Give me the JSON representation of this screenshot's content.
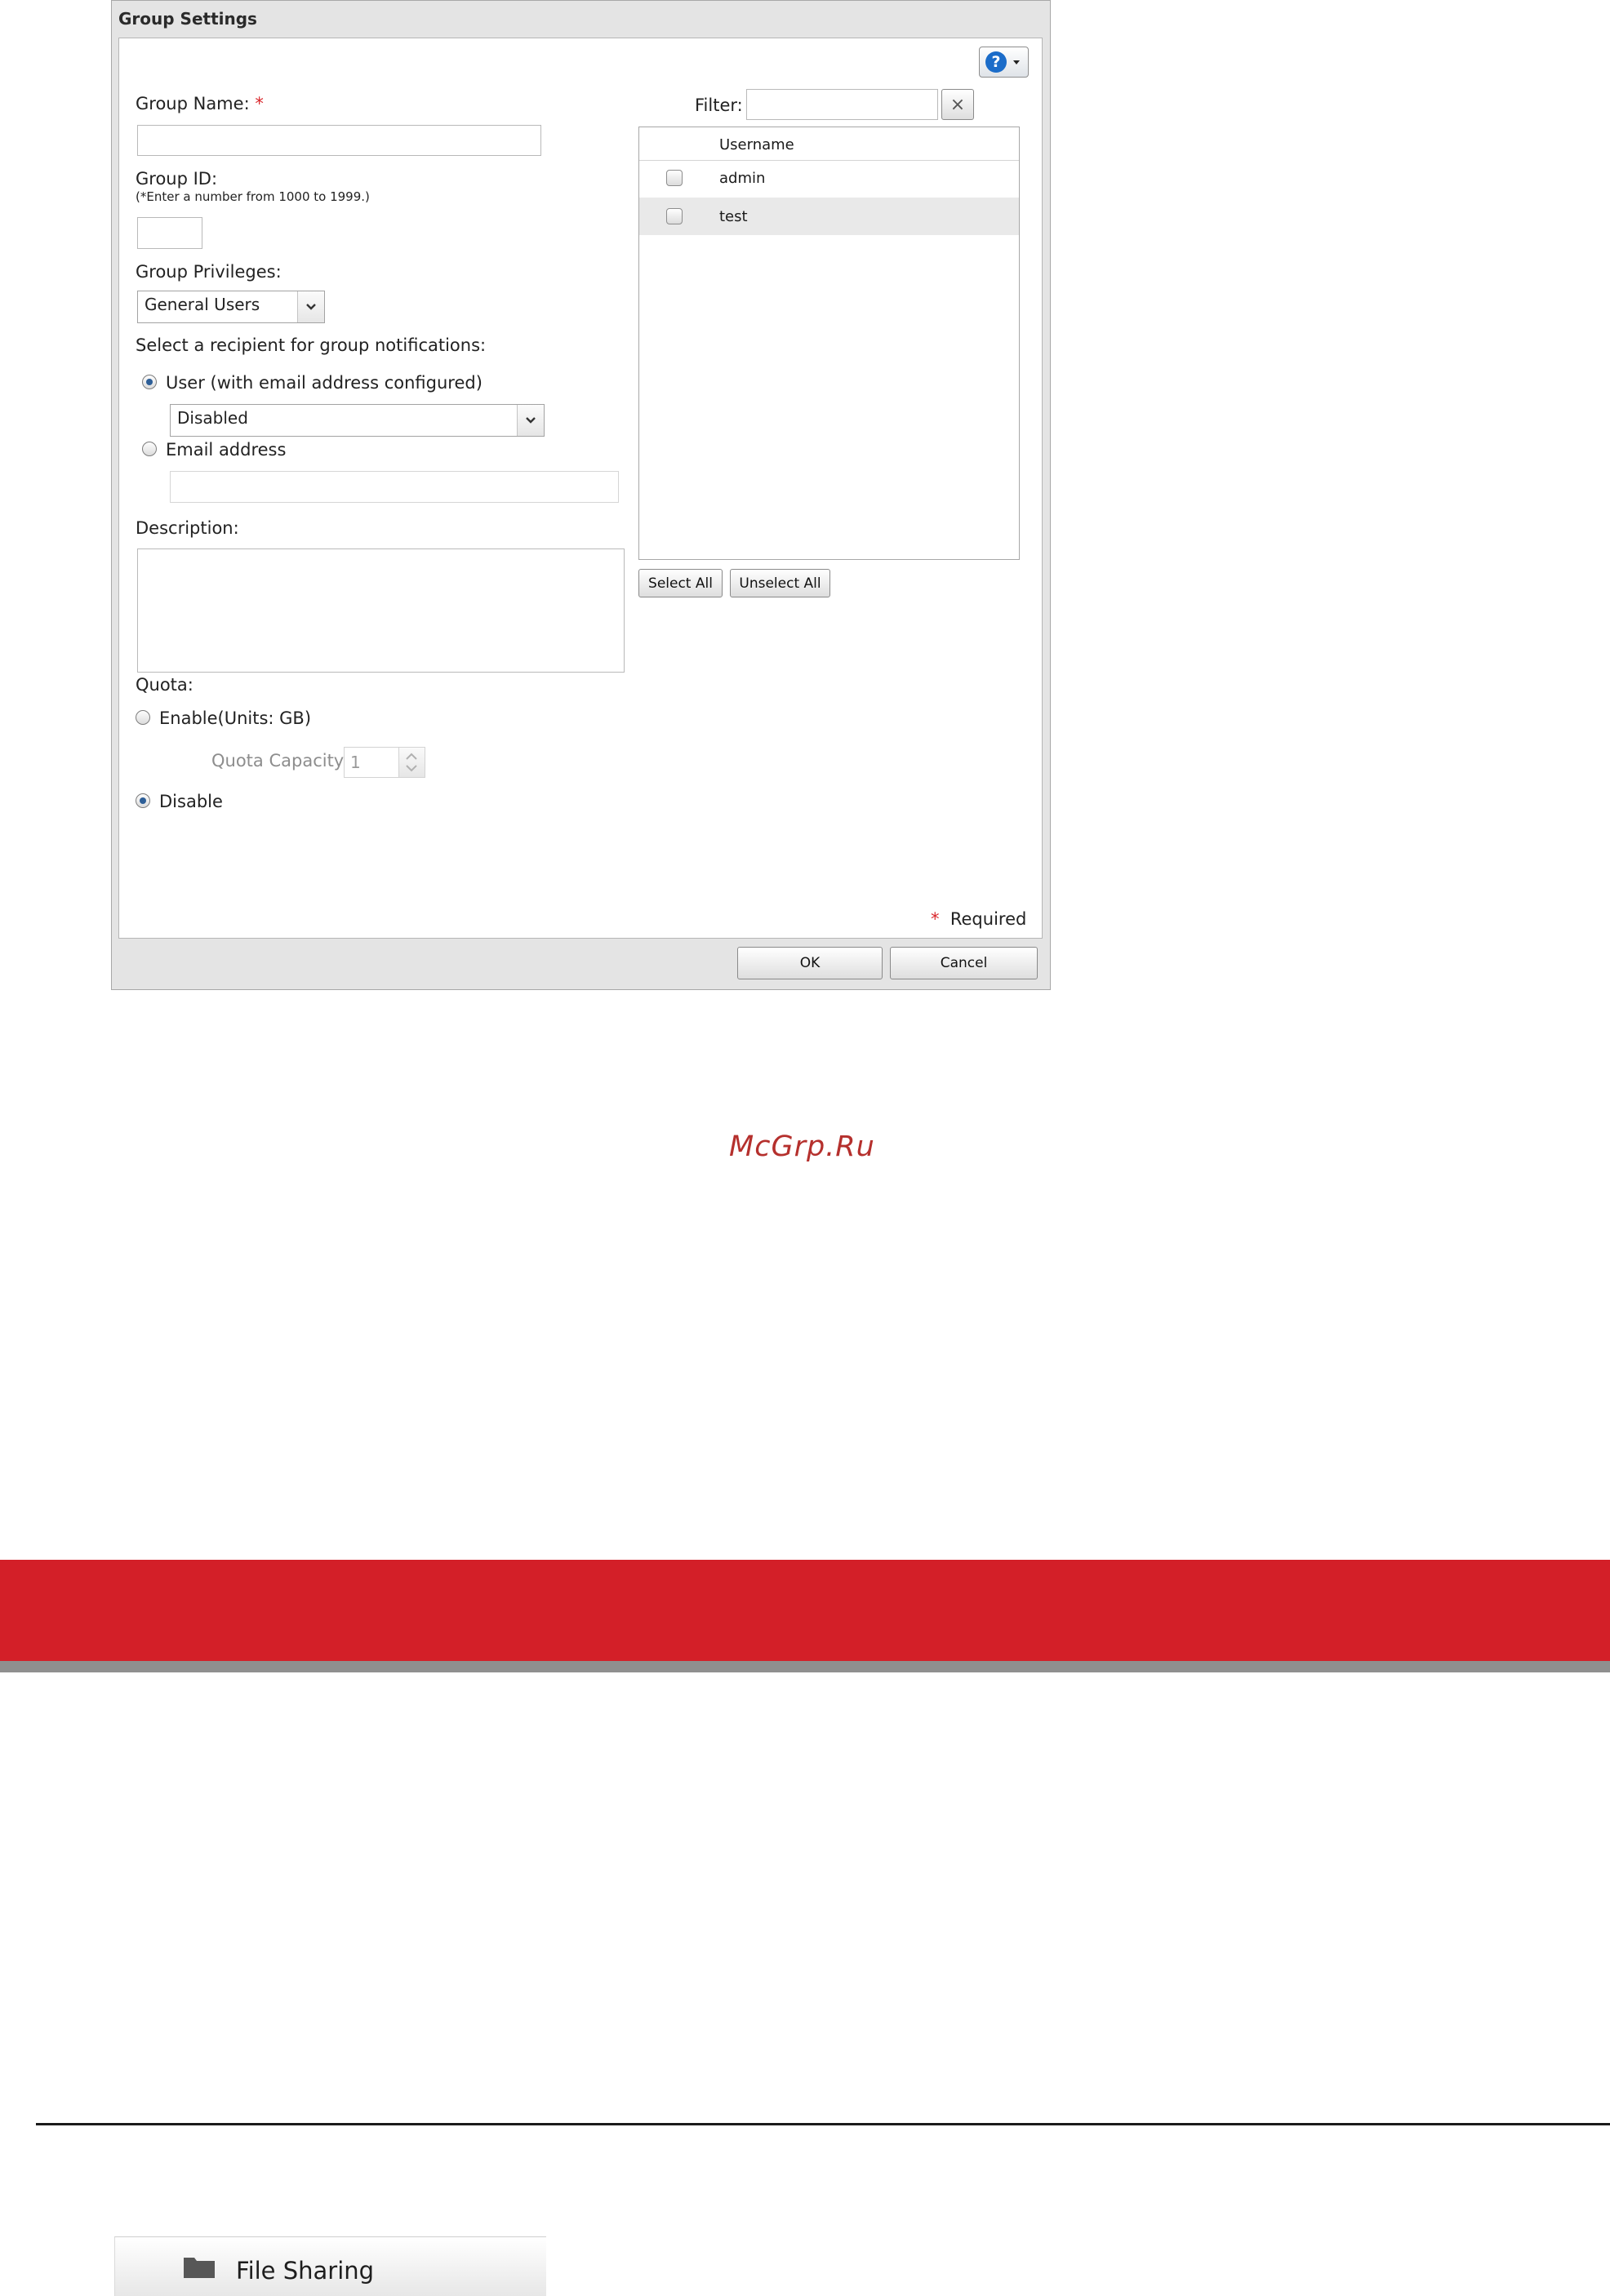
{
  "dialog": {
    "title": "Group Settings",
    "group_name_label": "Group Name:",
    "required_mark": "*",
    "group_id_label": "Group ID:",
    "group_id_hint": "(*Enter a number from 1000 to 1999.)",
    "privileges_label": "Group Privileges:",
    "privileges_value": "General Users",
    "notification_label": "Select a recipient for group notifications:",
    "radio_user_label": "User (with email address configured)",
    "user_select_value": "Disabled",
    "radio_email_label": "Email address",
    "description_label": "Description:",
    "quota_label": "Quota:",
    "quota_enable_label": "Enable(Units: GB)",
    "quota_capacity_label": "Quota Capacity:",
    "quota_capacity_value": "1",
    "quota_disable_label": "Disable",
    "filter_label": "Filter:",
    "filter_clear": "×",
    "help_glyph": "?",
    "user_list": {
      "column_header": "Username",
      "rows": [
        {
          "username": "admin"
        },
        {
          "username": "test"
        }
      ]
    },
    "select_all_label": "Select All",
    "unselect_all_label": "Unselect All",
    "required_note": "Required",
    "ok_label": "OK",
    "cancel_label": "Cancel"
  },
  "watermark": "McGrp.Ru",
  "nav_item": {
    "label": "File Sharing",
    "icon": "folder-icon"
  },
  "colors": {
    "band_red": "#d31f28",
    "required_red": "#d9262b",
    "help_blue": "#1b6cc9",
    "watermark_red": "#b5302d"
  }
}
